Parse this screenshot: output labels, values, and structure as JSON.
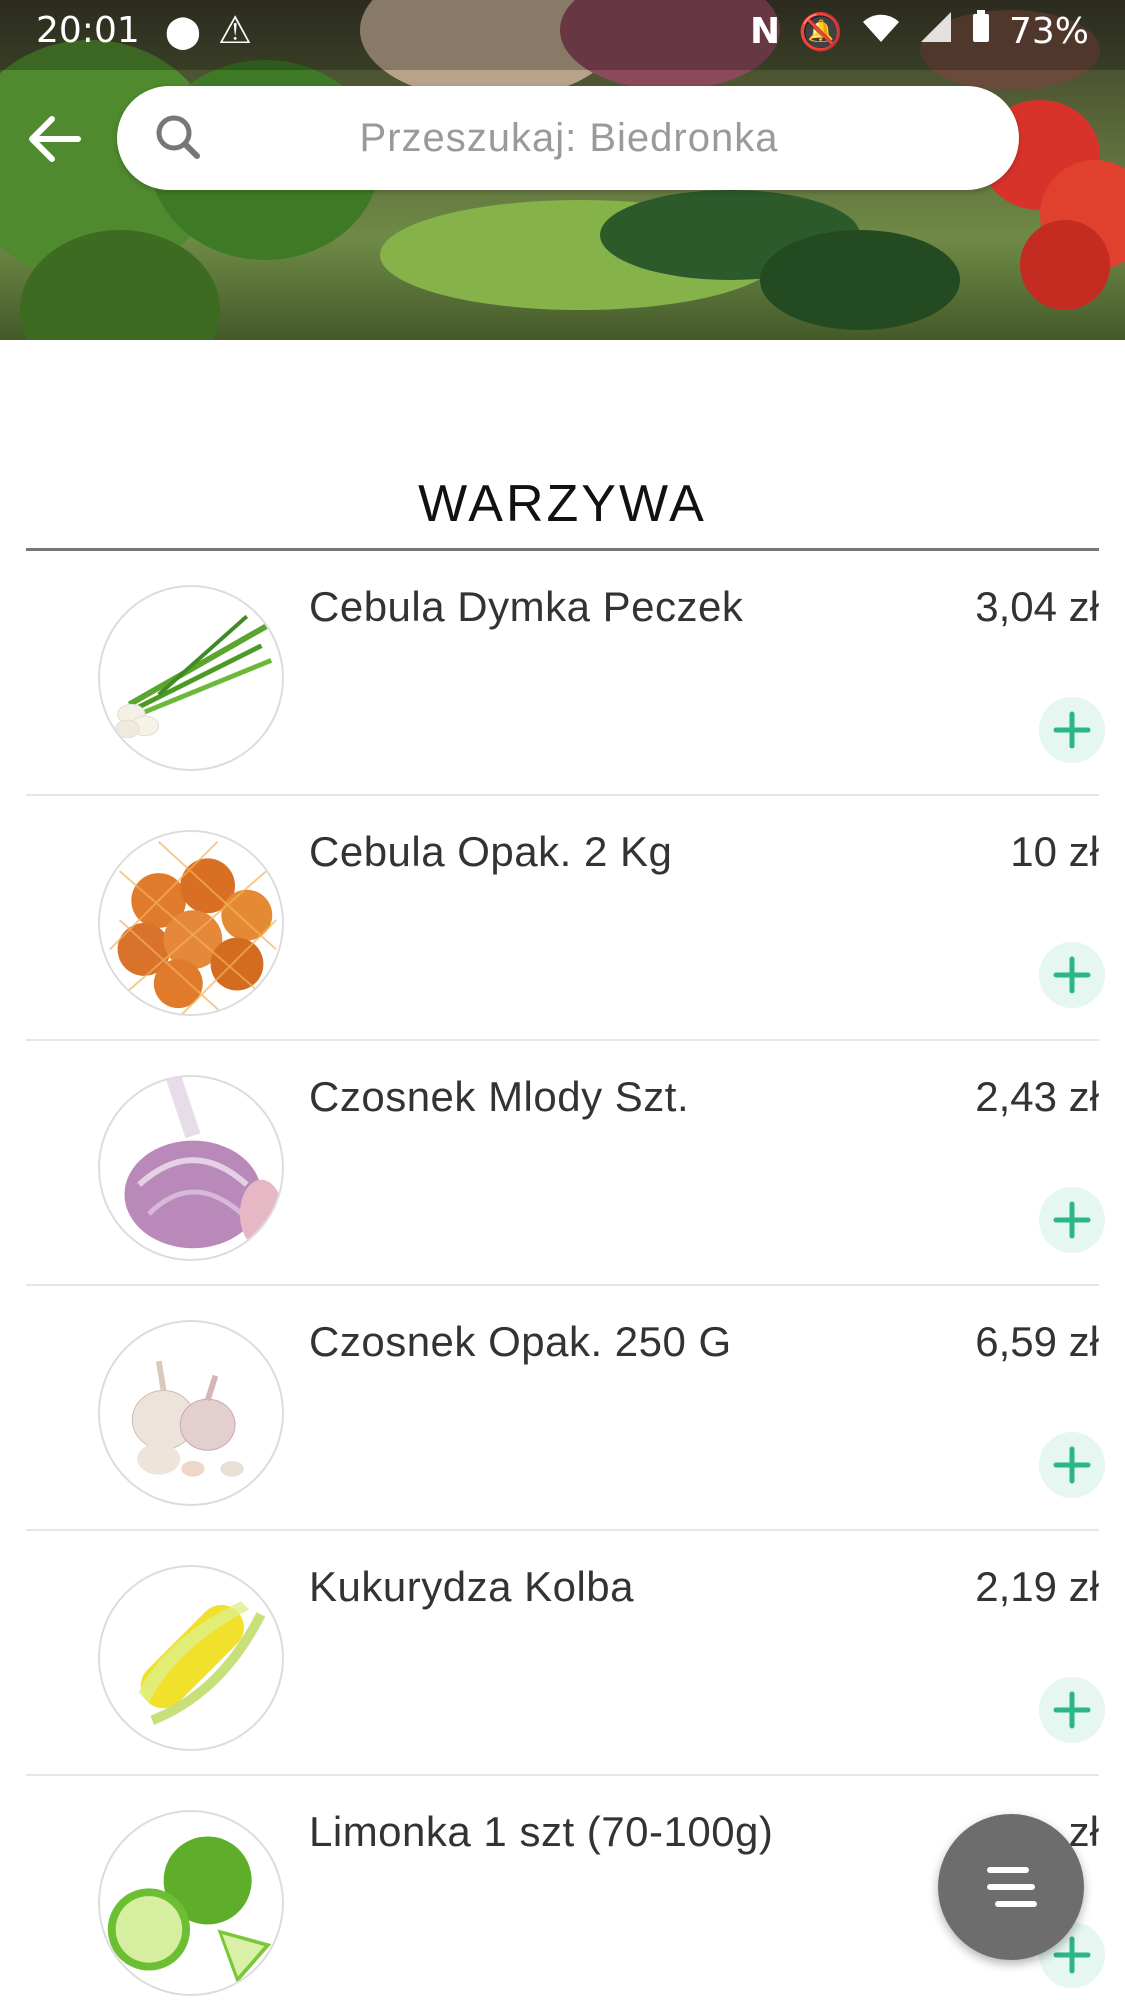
{
  "status_bar": {
    "time": "20:01",
    "battery": "73%",
    "icons": [
      "location-icon",
      "warning-icon",
      "nfc-icon",
      "bell-off-icon",
      "wifi-icon",
      "signal-icon",
      "battery-icon"
    ]
  },
  "search": {
    "placeholder": "Przeszukaj: Biedronka"
  },
  "category": {
    "title": "WARZYWA"
  },
  "products": [
    {
      "name": "Cebula Dymka Peczek",
      "price": "3,04 zł",
      "image": "spring-onion"
    },
    {
      "name": "Cebula Opak. 2 Kg",
      "price": "10 zł",
      "image": "onion-bag"
    },
    {
      "name": "Czosnek Mlody Szt.",
      "price": "2,43 zł",
      "image": "young-garlic"
    },
    {
      "name": "Czosnek Opak. 250 G",
      "price": "6,59 zł",
      "image": "garlic-pack"
    },
    {
      "name": "Kukurydza Kolba",
      "price": "2,19 zł",
      "image": "corn"
    },
    {
      "name": "Limonka 1 szt (70-100g)",
      "price": "zł",
      "image": "lime"
    }
  ],
  "colors": {
    "accent": "#2bb58a",
    "accent_bg": "#e6f6f1",
    "fab": "#6d6d6d"
  }
}
